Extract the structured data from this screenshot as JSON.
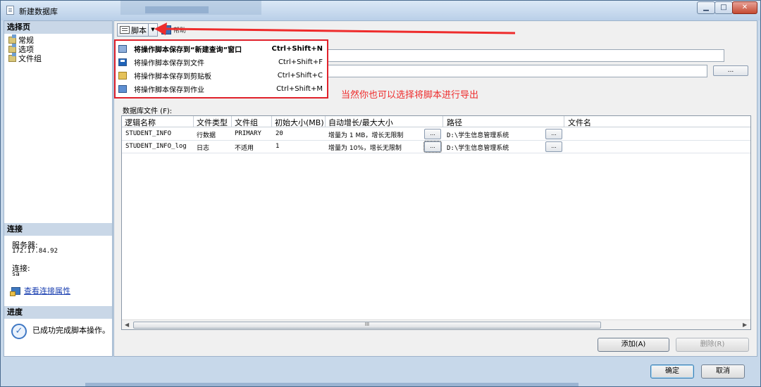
{
  "window": {
    "title": "新建数据库"
  },
  "left": {
    "select_page_header": "选择页",
    "pages": [
      "常规",
      "选项",
      "文件组"
    ],
    "connection_header": "连接",
    "server_label": "服务器:",
    "server_value": "172.17.84.92",
    "connection_label": "连接:",
    "connection_value": "sa",
    "view_connection_properties": "查看连接属性",
    "progress_header": "进度",
    "progress_status": "已成功完成脚本操作。"
  },
  "toolbar": {
    "script_label": "脚本",
    "help_label": "帮助"
  },
  "script_menu": {
    "items": [
      {
        "label": "将操作脚本保存到“新建查询”窗口",
        "shortcut": "Ctrl+Shift+N"
      },
      {
        "label": "将操作脚本保存到文件",
        "shortcut": "Ctrl+Shift+F"
      },
      {
        "label": "将操作脚本保存到剪贴板",
        "shortcut": "Ctrl+Shift+C"
      },
      {
        "label": "将操作脚本保存到作业",
        "shortcut": "Ctrl+Shift+M"
      }
    ]
  },
  "annotation": "当然你也可以选择将脚本进行导出",
  "grid": {
    "label": "数据库文件 (F):",
    "columns": [
      "逻辑名称",
      "文件类型",
      "文件组",
      "初始大小(MB)",
      "自动增长/最大大小",
      "路径",
      "文件名"
    ],
    "rows": [
      {
        "logical_name": "STUDENT_INFO",
        "file_type": "行数据",
        "filegroup": "PRIMARY",
        "initial_size": "20",
        "autogrowth": "增量为 1 MB，增长无限制",
        "path": "D:\\学生信息管理系统"
      },
      {
        "logical_name": "STUDENT_INFO_log",
        "file_type": "日志",
        "filegroup": "不适用",
        "initial_size": "1",
        "autogrowth": "增量为 10%，增长无限制",
        "path": "D:\\学生信息管理系统"
      }
    ],
    "ellipsis": "...",
    "scroll_grip": "III"
  },
  "buttons": {
    "add": "添加(A)",
    "remove": "删除(R)",
    "ok": "确定",
    "cancel": "取消"
  },
  "colors": {
    "annotation": "#ee2c2c",
    "highlight_border": "#e0212b",
    "link": "#1a3fb0"
  }
}
